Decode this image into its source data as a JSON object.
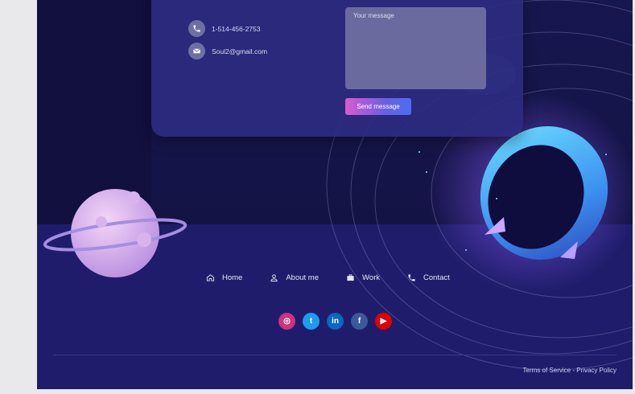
{
  "contact": {
    "phone": "1-514-456-2753",
    "email": "Soul2@gmail.com",
    "message_placeholder": "Your message",
    "send_label": "Send message"
  },
  "nav": {
    "items": [
      {
        "label": "Home",
        "icon": "home-icon"
      },
      {
        "label": "About me",
        "icon": "user-icon"
      },
      {
        "label": "Work",
        "icon": "briefcase-icon"
      },
      {
        "label": "Contact",
        "icon": "phone-icon"
      }
    ]
  },
  "socials": [
    {
      "name": "instagram-icon",
      "glyph": "◎",
      "color": "#c9347f"
    },
    {
      "name": "twitter-icon",
      "glyph": "t",
      "color": "#1d9bf0"
    },
    {
      "name": "linkedin-icon",
      "glyph": "in",
      "color": "#0a66c2"
    },
    {
      "name": "facebook-icon",
      "glyph": "f",
      "color": "#3b5998"
    },
    {
      "name": "youtube-icon",
      "glyph": "▶",
      "color": "#e00000"
    }
  ],
  "footer": {
    "terms": "Terms of Service",
    "separator": " - ",
    "privacy": "Privacy Policy"
  },
  "colors": {
    "background": "#1b1a61",
    "card": "#2c2b80",
    "accent_start": "#d85bd0",
    "accent_end": "#4a6ef0"
  }
}
